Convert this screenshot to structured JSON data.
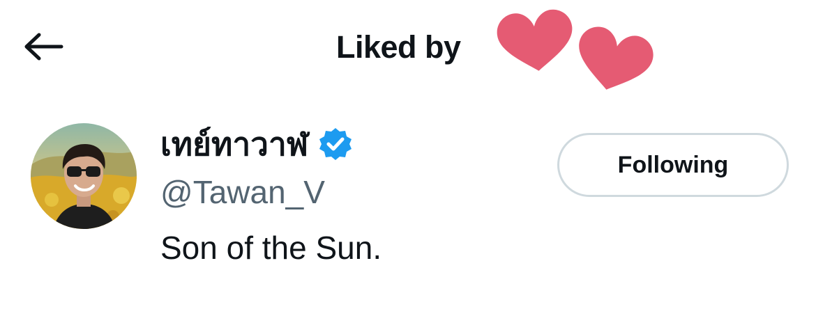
{
  "header": {
    "back_icon": "arrow-left-icon",
    "title": "Liked by",
    "decoration_icon": "hearts-icon",
    "heart_color": "#e55b73"
  },
  "users": [
    {
      "display_name": "เทย์ทาวาฬ",
      "verified": true,
      "verified_icon": "verified-badge-icon",
      "verified_color": "#1d9bf0",
      "handle": "@Tawan_V",
      "bio": "Son of the Sun.",
      "follow_button_label": "Following"
    }
  ],
  "colors": {
    "text_primary": "#0f1419",
    "text_secondary": "#536471",
    "button_border": "#cfd9de"
  }
}
